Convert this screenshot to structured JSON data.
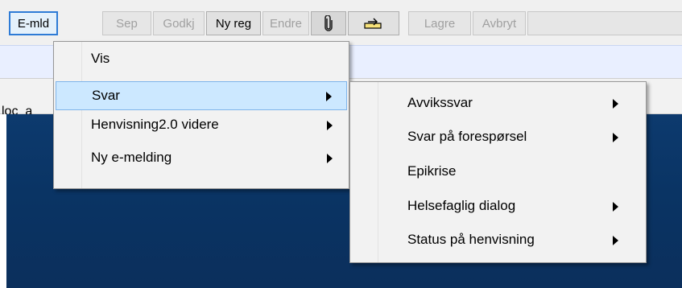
{
  "toolbar": {
    "buttons": [
      {
        "label": "E-mld"
      },
      {
        "label": "Sep"
      },
      {
        "label": "Godkj"
      },
      {
        "label": "Ny reg"
      },
      {
        "label": "Endre"
      },
      {
        "icon": "paperclip-icon"
      },
      {
        "icon": "tray-arrow-icon"
      },
      {
        "label": "Lagre"
      },
      {
        "label": "Avbryt"
      }
    ]
  },
  "background": {
    "tab_label": "loc_a"
  },
  "menu": {
    "items": [
      {
        "label": "Vis",
        "has_submenu": false
      },
      {
        "label": "Svar",
        "has_submenu": true,
        "active": true
      },
      {
        "label": "Henvisning2.0 videre",
        "has_submenu": true
      },
      {
        "label": "Ny e-melding",
        "has_submenu": true
      }
    ]
  },
  "submenu": {
    "items": [
      {
        "label": "Avvikssvar",
        "has_submenu": true
      },
      {
        "label": "Svar på forespørsel",
        "has_submenu": true
      },
      {
        "label": "Epikrise",
        "has_submenu": false
      },
      {
        "label": "Helsefaglig dialog",
        "has_submenu": true
      },
      {
        "label": "Status på henvisning",
        "has_submenu": true
      }
    ]
  },
  "colors": {
    "focus_border": "#2e7bd6",
    "highlight_bg": "#cce8ff",
    "dark_panel": "#0a3464"
  }
}
